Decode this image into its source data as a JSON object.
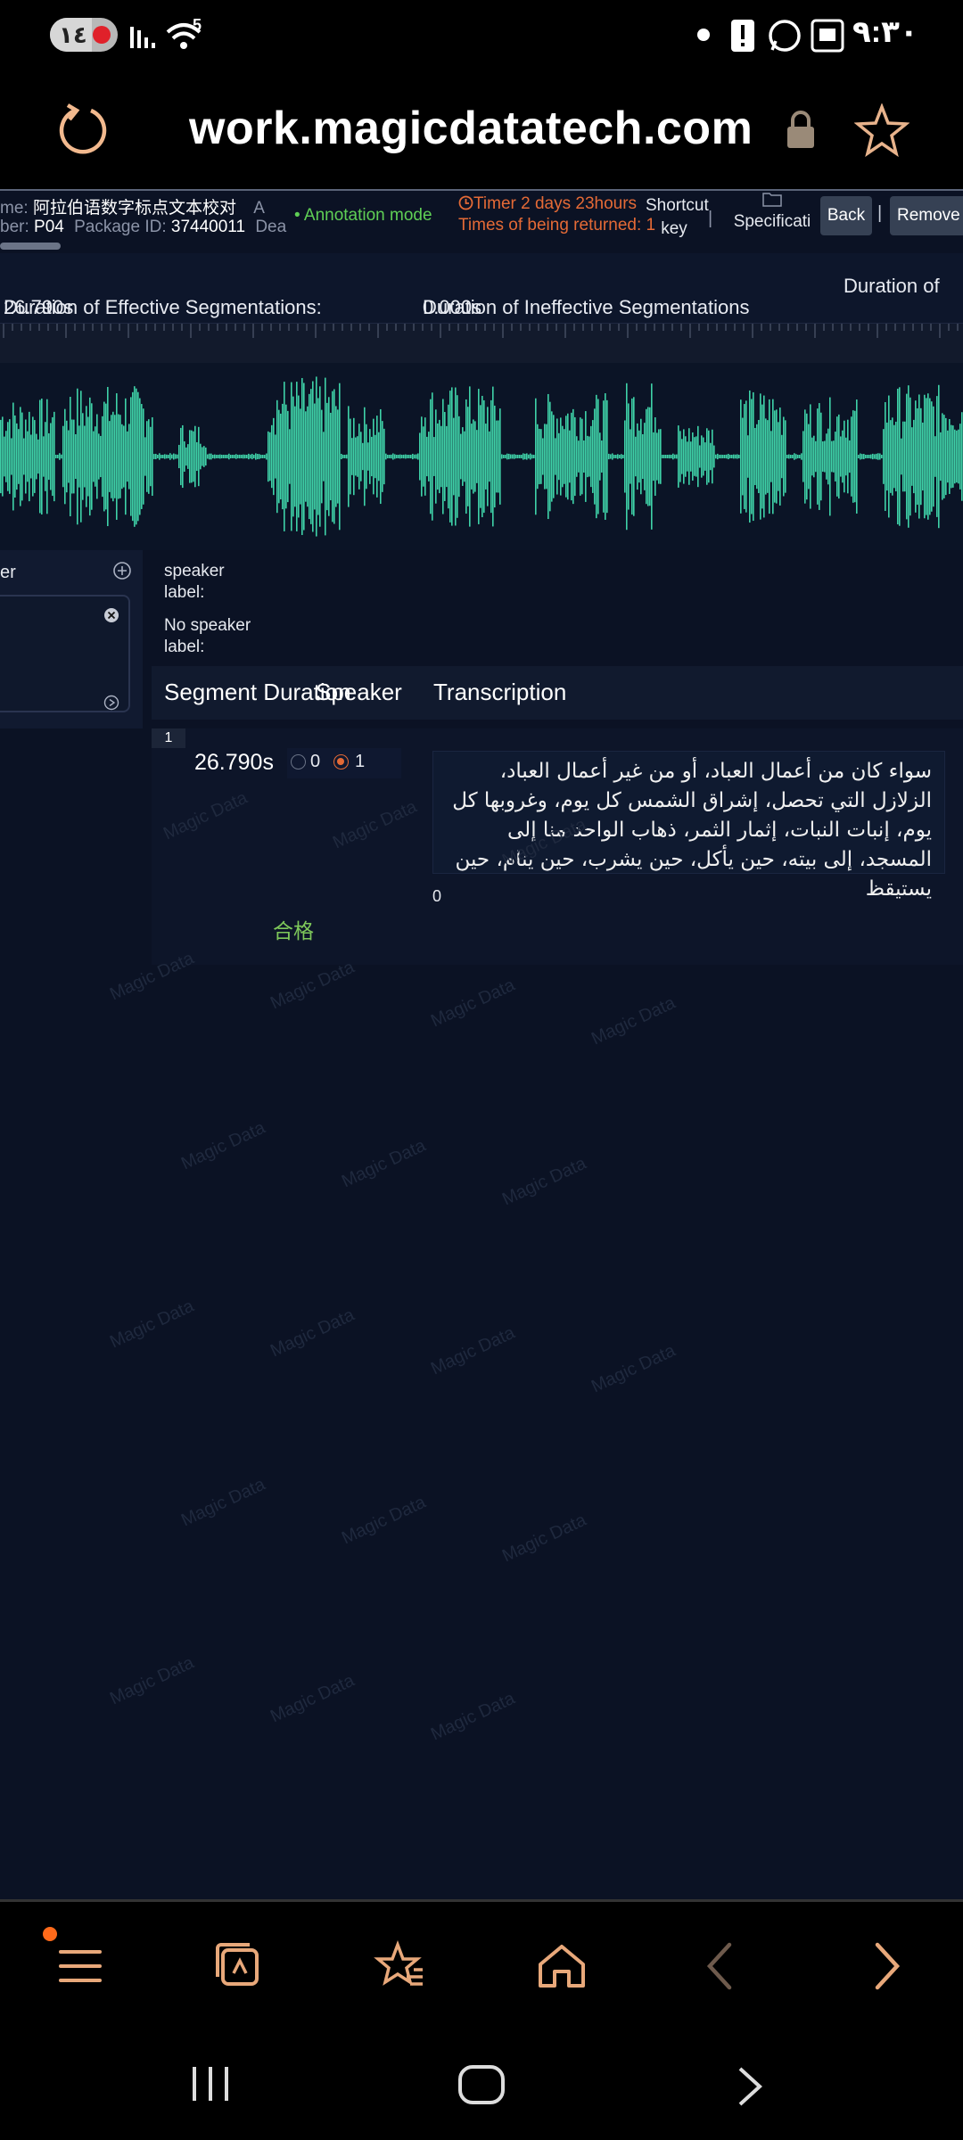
{
  "status_bar": {
    "battery": "١٤",
    "time": "٩:٣٠",
    "wifi_badge": "5"
  },
  "browser": {
    "url": "work.magicdatatech.com"
  },
  "task": {
    "name_prefix": "me:",
    "name_value": "阿拉伯语数字标点文本校对",
    "name_suffix": "A",
    "number_prefix": "ber:",
    "number_value": "P04",
    "package_label": "Package ID:",
    "package_value": "37440011",
    "deadline_cut": "Dea",
    "mode": "Annotation mode",
    "timer": "Timer 2 days 23hours",
    "returned_label": "Times of being returned:",
    "returned_value": "1",
    "shortcut_key": "Shortcut key",
    "specification": "Specificati",
    "back": "Back",
    "remove": "Remove",
    "separator": "|"
  },
  "stats": {
    "effective_label": "Duration of Effective Segmentations:",
    "effective_value": "26.790s",
    "ineffective_label": "Duration of Ineffective Segmentations",
    "ineffective_value": "0.000s",
    "third_label": "Duration of"
  },
  "left_panel": {
    "label_cut": "er"
  },
  "speaker": {
    "speaker_label": "speaker label:",
    "no_speaker_label": "No speaker label:"
  },
  "table": {
    "headers": {
      "duration": "Segment Duration",
      "speaker": "Speaker",
      "transcription": "Transcription"
    },
    "rows": [
      {
        "index": "1",
        "duration": "26.790s",
        "speaker_options": [
          "0",
          "1"
        ],
        "selected_speaker": "1",
        "transcription": "سواء كان من أعمال العباد، أو من غير أعمال العباد، الزلازل التي تحصل، إشراق الشمس كل يوم، وغروبها كل يوم،  إنبات النبات، إثمار الثمر، ذهاب الواحد منا إلى المسجد، إلى بيته، حين يأكل، حين يشرب، حين ينام، حين يستيقظ",
        "sub_value": "0",
        "status": "合格"
      }
    ]
  },
  "watermark_text": "Magic Data",
  "colors": {
    "accent_orange": "#e46a36",
    "waveform": "#3fd2a8",
    "mode_green": "#5fcf55",
    "background": "#0b1224"
  }
}
